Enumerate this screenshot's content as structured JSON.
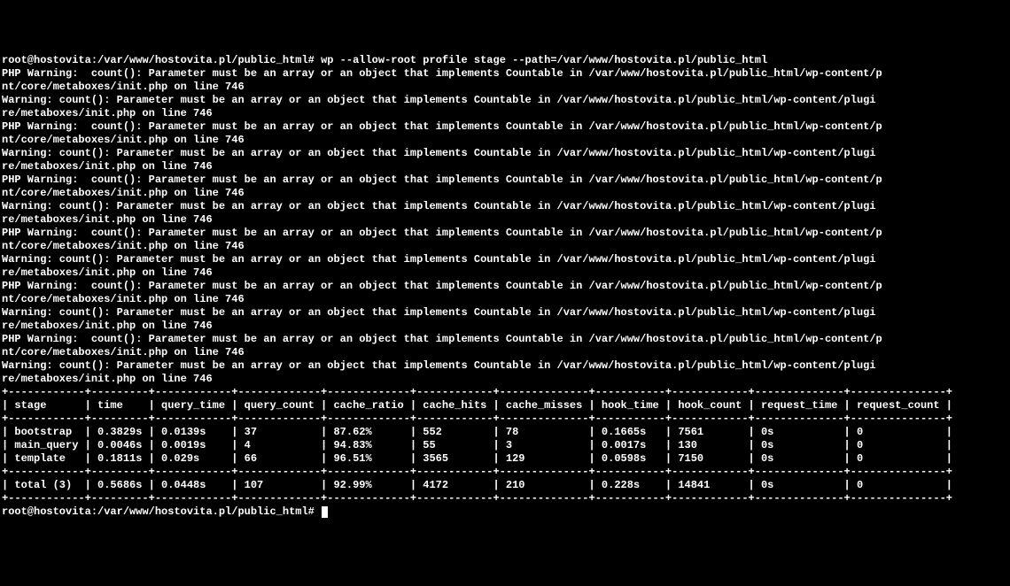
{
  "prompt1": {
    "user_host": "root@hostovita",
    "path": ":/var/www/hostovita.pl/public_html#",
    "command": " wp --allow-root profile stage --path=/var/www/hostovita.pl/public_html"
  },
  "warn_php": "PHP Warning:  count(): Parameter must be an array or an object that implements Countable in /var/www/hostovita.pl/public_html/wp-content/p",
  "warn_php2": "nt/core/metaboxes/init.php on line 746",
  "warn": "Warning: count(): Parameter must be an array or an object that implements Countable in /var/www/hostovita.pl/public_html/wp-content/plugi",
  "warn2": "re/metaboxes/init.php on line 746",
  "warn_repeat_count": 6,
  "table": {
    "sep": "+",
    "headers": [
      "stage",
      "time",
      "query_time",
      "query_count",
      "cache_ratio",
      "cache_hits",
      "cache_misses",
      "hook_time",
      "hook_count",
      "request_time",
      "request_count"
    ],
    "widths": [
      12,
      9,
      12,
      13,
      13,
      12,
      14,
      11,
      12,
      14,
      15
    ],
    "rows": [
      [
        "bootstrap",
        "0.3829s",
        "0.0139s",
        "37",
        "87.62%",
        "552",
        "78",
        "0.1665s",
        "7561",
        "0s",
        "0"
      ],
      [
        "main_query",
        "0.0046s",
        "0.0019s",
        "4",
        "94.83%",
        "55",
        "3",
        "0.0017s",
        "130",
        "0s",
        "0"
      ],
      [
        "template",
        "0.1811s",
        "0.029s",
        "66",
        "96.51%",
        "3565",
        "129",
        "0.0598s",
        "7150",
        "0s",
        "0"
      ]
    ],
    "total": [
      "total (3)",
      "0.5686s",
      "0.0448s",
      "107",
      "92.99%",
      "4172",
      "210",
      "0.228s",
      "14841",
      "0s",
      "0"
    ]
  },
  "prompt2": {
    "user_host": "root@hostovita",
    "path": ":/var/www/hostovita.pl/public_html#"
  }
}
